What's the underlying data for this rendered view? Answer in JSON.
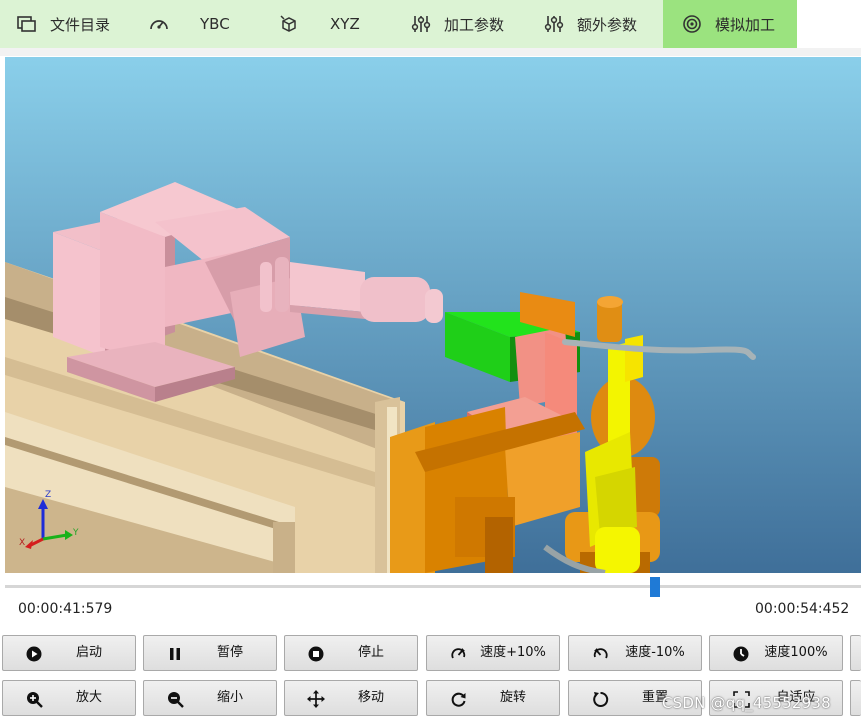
{
  "tabs": [
    {
      "label": "文件目录",
      "icon": "file-directory-icon"
    },
    {
      "label": "YBC",
      "icon": "gauge-icon"
    },
    {
      "label": "XYZ",
      "icon": "cube-axes-icon"
    },
    {
      "label": "加工参数",
      "icon": "sliders-icon"
    },
    {
      "label": "额外参数",
      "icon": "sliders-icon"
    },
    {
      "label": "模拟加工",
      "icon": "target-icon",
      "active": true
    }
  ],
  "viewport": {
    "axis_triad": {
      "x": "X",
      "y": "Y",
      "z": "Z"
    },
    "background_top": "#8acfea",
    "background_bottom": "#3f6f99"
  },
  "playback": {
    "current_time": "00:00:41:579",
    "total_time": "00:00:54:452",
    "progress": 0.763
  },
  "buttons_row1": [
    {
      "label": "启动",
      "icon": "play-icon"
    },
    {
      "label": "暂停",
      "icon": "pause-icon"
    },
    {
      "label": "停止",
      "icon": "stop-icon"
    },
    {
      "label": "速度+10%",
      "icon": "speed-up-icon"
    },
    {
      "label": "速度-10%",
      "icon": "speed-down-icon"
    },
    {
      "label": "速度100%",
      "icon": "speed-reset-icon"
    }
  ],
  "buttons_row2": [
    {
      "label": "放大",
      "icon": "zoom-in-icon"
    },
    {
      "label": "缩小",
      "icon": "zoom-out-icon"
    },
    {
      "label": "移动",
      "icon": "move-icon"
    },
    {
      "label": "旋转",
      "icon": "rotate-icon"
    },
    {
      "label": "重置",
      "icon": "reset-icon"
    },
    {
      "label": "自适应",
      "icon": "fit-screen-icon"
    }
  ],
  "watermark": "CSDN @qq_45552938",
  "colors": {
    "tab_bar": "#dcf3d4",
    "tab_active": "#9be37f",
    "slider_thumb": "#1f7ad6"
  }
}
